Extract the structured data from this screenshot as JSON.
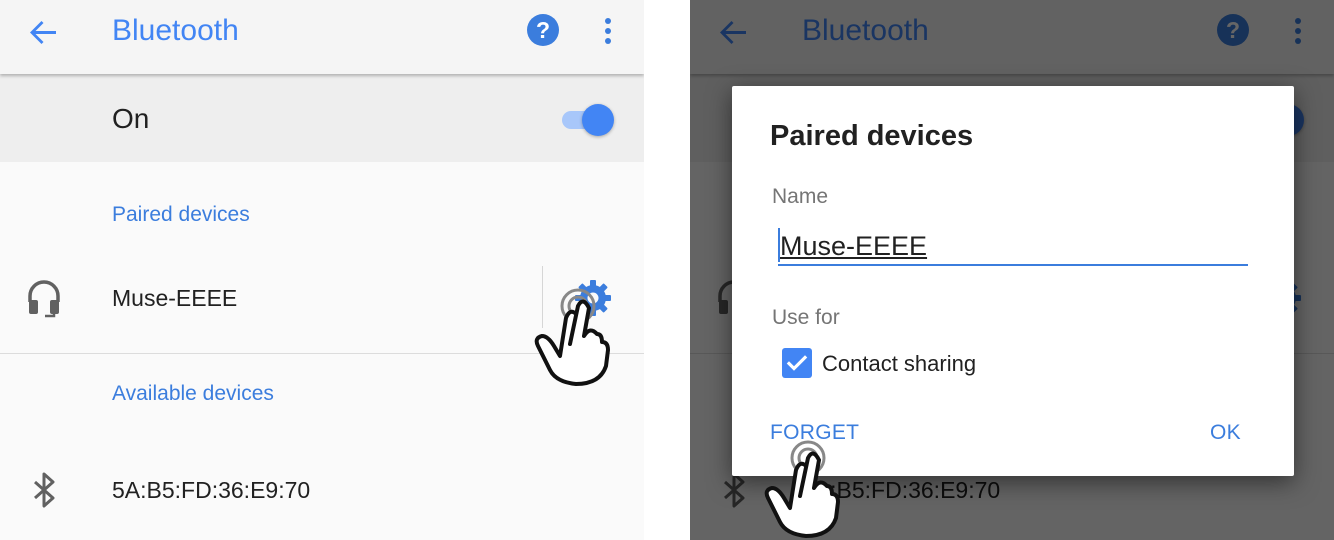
{
  "screen": {
    "title": "Bluetooth",
    "toggle_label": "On",
    "toggle_on": true,
    "paired_header": "Paired devices",
    "available_header": "Available devices",
    "paired_devices": [
      {
        "name": "Muse-EEEE",
        "icon": "headset-icon",
        "action_icon": "gear-icon"
      }
    ],
    "available_devices": [
      {
        "name": "5A:B5:FD:36:E9:70",
        "icon": "bluetooth-icon"
      }
    ],
    "icons": {
      "back": "arrow-back-icon",
      "help": "help-icon",
      "more": "more-vert-icon",
      "tap": "hand-pointer-icon"
    }
  },
  "dialog": {
    "title": "Paired devices",
    "name_label": "Name",
    "name_value": "Muse-EEEE",
    "use_for_label": "Use for",
    "contact_sharing_label": "Contact sharing",
    "contact_sharing_checked": true,
    "forget_label": "FORGET",
    "ok_label": "OK"
  },
  "colors": {
    "accent": "#4285f4",
    "link": "#3b7ddd",
    "text": "#212121",
    "secondary_text": "#757575",
    "appbar_bg": "#f5f5f5",
    "toggle_bar_bg": "#eeeeee"
  }
}
